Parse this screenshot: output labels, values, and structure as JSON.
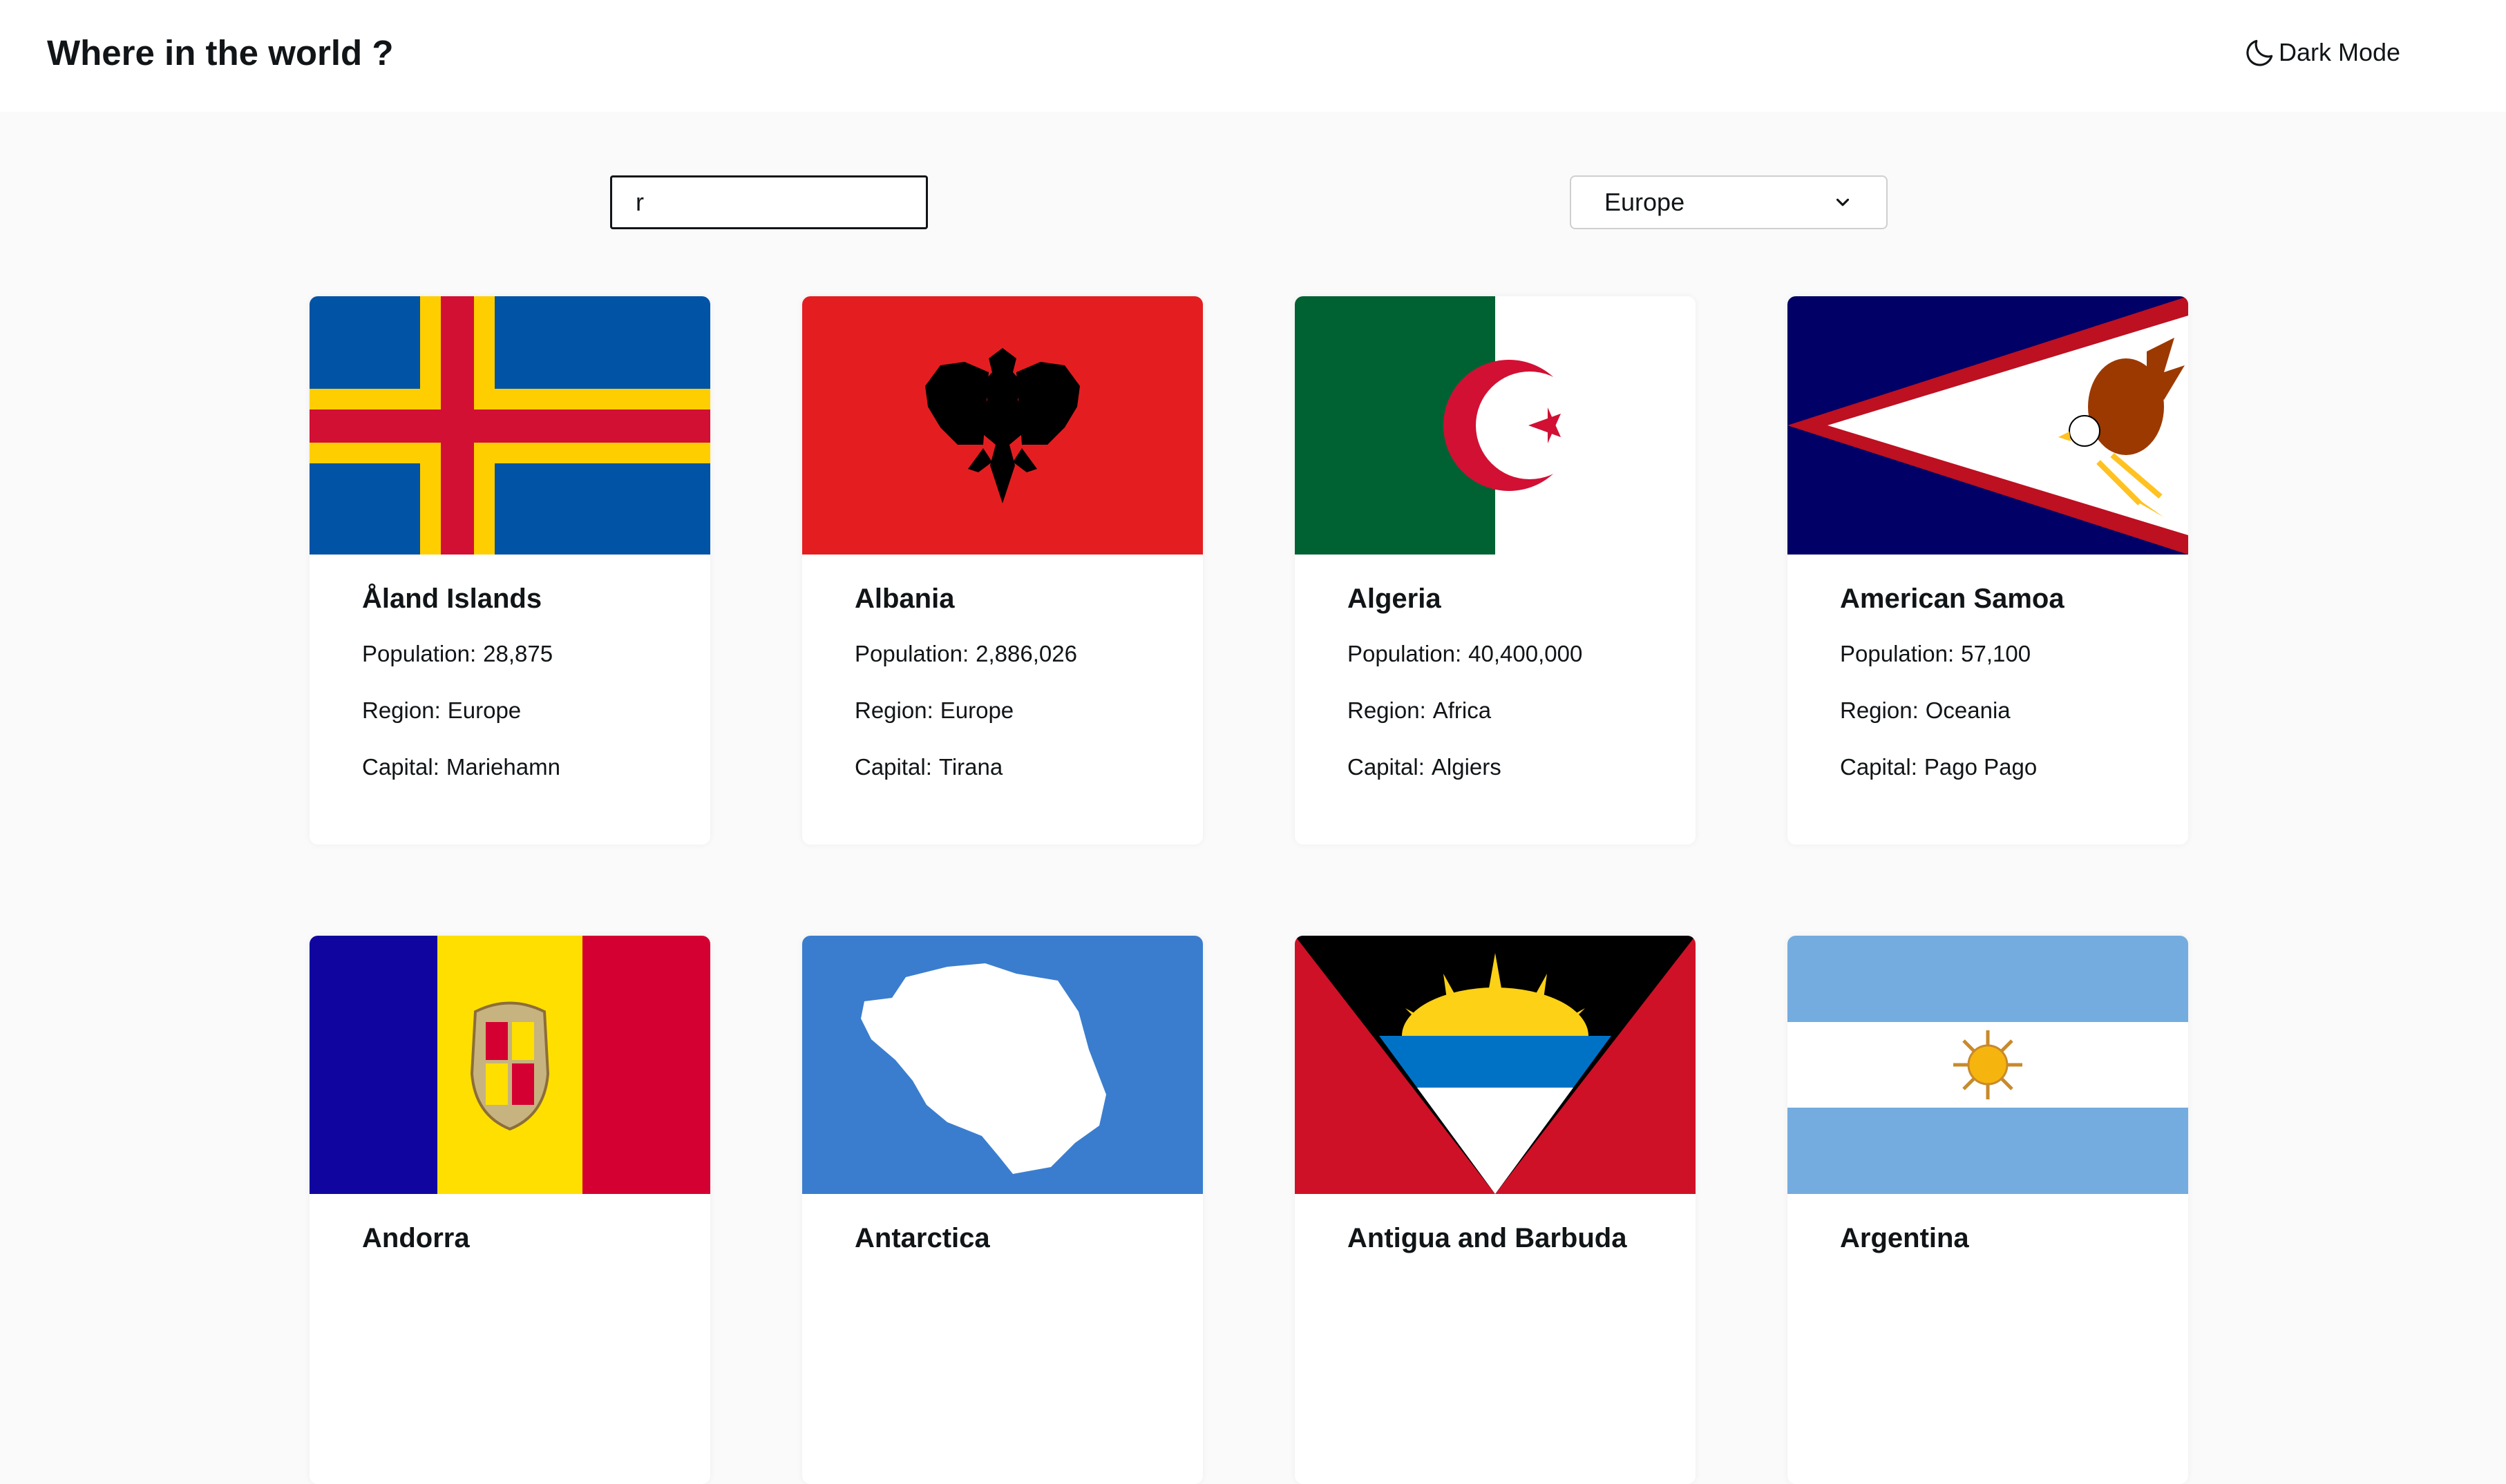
{
  "header": {
    "title": "Where in the world ?",
    "theme_toggle_label": "Dark Mode",
    "theme_icon": "moon-icon"
  },
  "search": {
    "value": "r"
  },
  "filter": {
    "selected": "Europe",
    "icon": "chevron-down-icon"
  },
  "stat_labels": {
    "population": "Population:",
    "region": "Region:",
    "capital": "Capital:"
  },
  "countries": [
    {
      "name": "Åland Islands",
      "population": "28,875",
      "region": "Europe",
      "capital": "Mariehamn"
    },
    {
      "name": "Albania",
      "population": "2,886,026",
      "region": "Europe",
      "capital": "Tirana"
    },
    {
      "name": "Algeria",
      "population": "40,400,000",
      "region": "Africa",
      "capital": "Algiers"
    },
    {
      "name": "American Samoa",
      "population": "57,100",
      "region": "Oceania",
      "capital": "Pago Pago"
    },
    {
      "name": "Andorra"
    },
    {
      "name": "Antarctica"
    },
    {
      "name": "Antigua and Barbuda"
    },
    {
      "name": "Argentina"
    }
  ]
}
